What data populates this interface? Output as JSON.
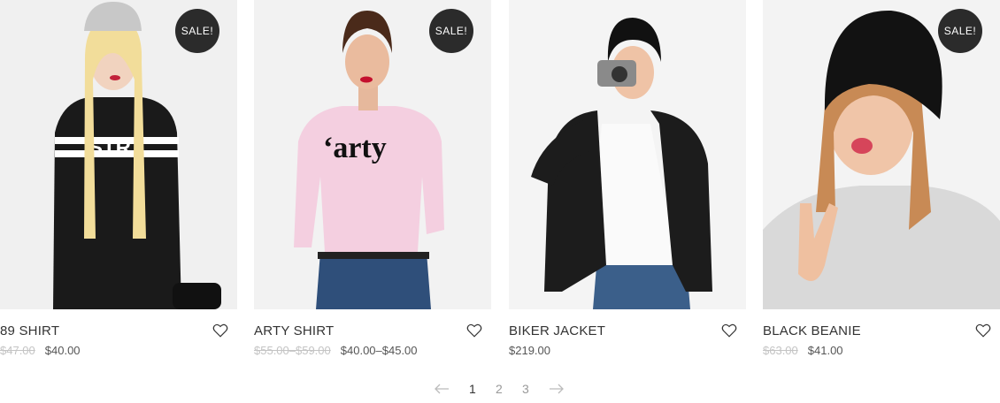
{
  "products": [
    {
      "title": "89 SHIRT",
      "badge": "SALE!",
      "old_price": "$47.00",
      "price": "$40.00",
      "shirt_text": "STR",
      "background": "#f0f0f0",
      "shirt_color": "#1a1a1a"
    },
    {
      "title": "ARTY SHIRT",
      "badge": "SALE!",
      "old_price": "$55.00–$59.00",
      "price": "$40.00–$45.00",
      "shirt_text": "‘arty",
      "background": "#f2f2f2",
      "shirt_color": "#f4cfe0"
    },
    {
      "title": "BIKER JACKET",
      "badge": "",
      "old_price": "",
      "price": "$219.00",
      "background": "#f4f4f4",
      "shirt_color": "#1c1c1c"
    },
    {
      "title": "BLACK BEANIE",
      "badge": "SALE!",
      "old_price": "$63.00",
      "price": "$41.00",
      "background": "#f3f3f3",
      "shirt_color": "#d9d9d9"
    }
  ],
  "pagination": {
    "pages": [
      "1",
      "2",
      "3"
    ],
    "current": "1",
    "prev_icon": "arrow-left-icon",
    "next_icon": "arrow-right-icon"
  },
  "icons": {
    "wishlist": "heart-outline-icon"
  },
  "colors": {
    "sale_badge": "#2b2b2b",
    "old_price": "#c4c4c4",
    "price": "#555555",
    "pager_active": "#333333",
    "pager_inactive": "#999999"
  }
}
